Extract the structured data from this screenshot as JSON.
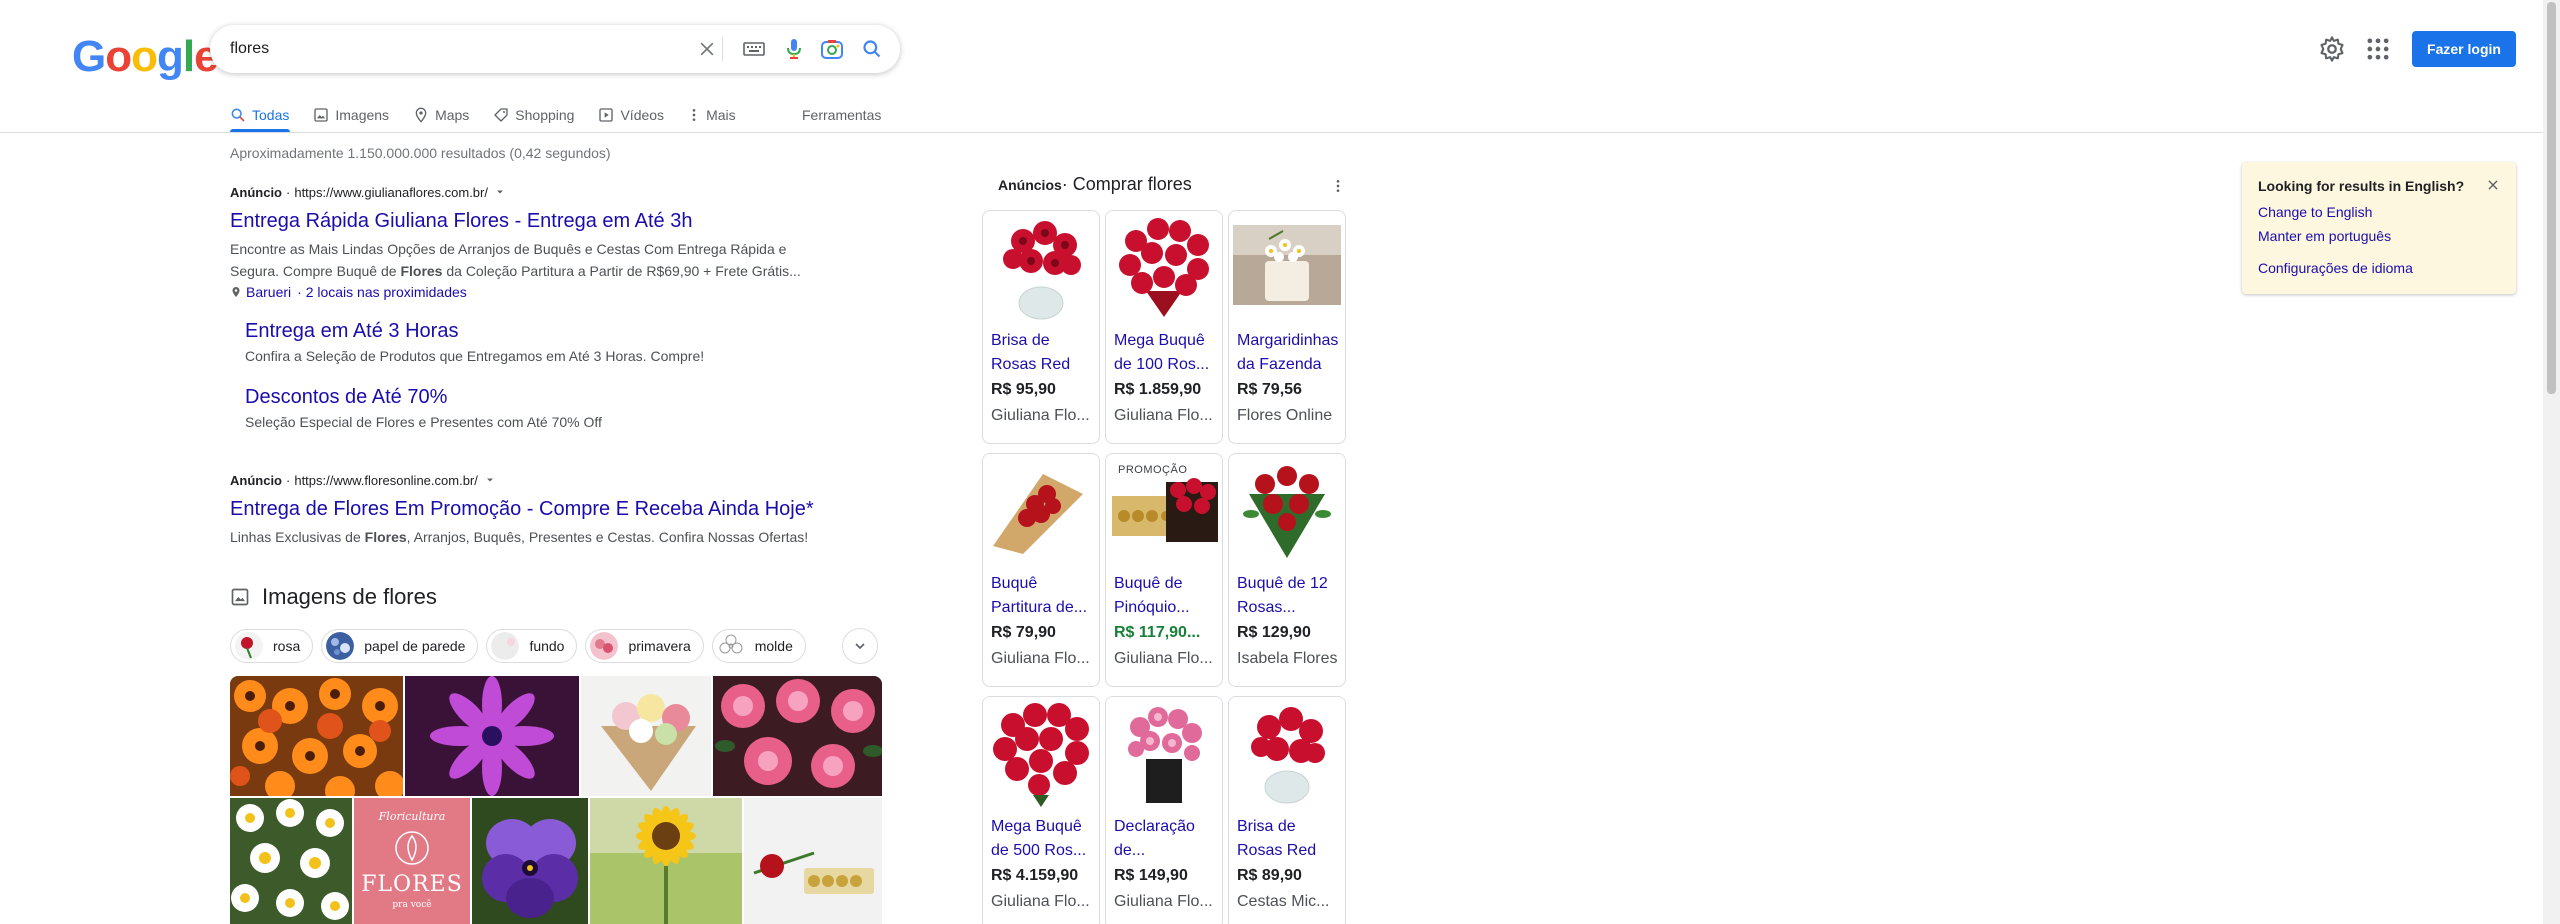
{
  "logo": [
    "G",
    "o",
    "o",
    "g",
    "l",
    "e"
  ],
  "search": {
    "value": "flores"
  },
  "header": {
    "login_label": "Fazer login"
  },
  "tabs": [
    {
      "label": "Todas"
    },
    {
      "label": "Imagens"
    },
    {
      "label": "Maps"
    },
    {
      "label": "Shopping"
    },
    {
      "label": "Vídeos"
    },
    {
      "label": "Mais"
    }
  ],
  "tools_label": "Ferramentas",
  "stats": "Aproximadamente 1.150.000.000 resultados (0,42 segundos)",
  "ads": [
    {
      "badge": "Anúncio",
      "sep": "·",
      "url": "https://www.giulianaflores.com.br/",
      "title": "Entrega Rápida Giuliana Flores - Entrega em Até 3h",
      "desc_1": "Encontre as Mais Lindas Opções de Arranjos de Buquês e Cestas Com Entrega Rápida e",
      "desc_2a": "Segura. Compre Buquê de ",
      "desc_2b": "Flores",
      "desc_2c": " da Coleção Partitura a Partir de R$69,90 + Frete Grátis...",
      "location": "Barueri",
      "location_extra": "· 2 locais nas proximidades",
      "sitelinks": [
        {
          "title": "Entrega em Até 3 Horas",
          "desc": "Confira a Seleção de Produtos que Entregamos em Até 3 Horas. Compre!"
        },
        {
          "title": "Descontos de Até 70%",
          "desc": "Seleção Especial de Flores e Presentes com Até 70% Off"
        }
      ]
    },
    {
      "badge": "Anúncio",
      "sep": "·",
      "url": "https://www.floresonline.com.br/",
      "title": "Entrega de Flores Em Promoção - Compre E Receba Ainda Hoje*",
      "desc_a": "Linhas Exclusivas de ",
      "desc_b": "Flores",
      "desc_c": ", Arranjos, Buquês, Presentes e Cestas. Confira Nossas Ofertas!"
    }
  ],
  "images_section": {
    "heading": "Imagens de flores",
    "chips": [
      "rosa",
      "papel de parede",
      "fundo",
      "primavera",
      "molde"
    ]
  },
  "shopping": {
    "label_bold": "Anúncios",
    "label": " · Comprar flores",
    "products": [
      {
        "title": "Brisa de Rosas Red",
        "price": "R$ 95,90",
        "store": "Giuliana Flo..."
      },
      {
        "title": "Mega Buquê de 100 Ros...",
        "price": "R$ 1.859,90",
        "store": "Giuliana Flo..."
      },
      {
        "title": "Margaridinhas da Fazenda",
        "price": "R$ 79,56",
        "store": "Flores Online"
      },
      {
        "title": "Buquê Partitura de...",
        "price": "R$ 79,90",
        "store": "Giuliana Flo..."
      },
      {
        "title": "Buquê de Pinóquio...",
        "price": "R$ 117,90...",
        "store": "Giuliana Flo...",
        "promo": "PROMOÇÃO"
      },
      {
        "title": "Buquê de 12 Rosas...",
        "price": "R$ 129,90",
        "store": "Isabela Flores"
      },
      {
        "title": "Mega Buquê de 500 Ros...",
        "price": "R$ 4.159,90",
        "store": "Giuliana Flo..."
      },
      {
        "title": "Declaração de...",
        "price": "R$ 149,90",
        "store": "Giuliana Flo..."
      },
      {
        "title": "Brisa de Rosas Red",
        "price": "R$ 89,90",
        "store": "Cestas Mic..."
      }
    ]
  },
  "language_box": {
    "title": "Looking for results in English?",
    "link_1": "Change to English",
    "link_2": "Manter em português",
    "link_3": "Configurações de idioma"
  },
  "colors": {
    "link": "#1a0dab",
    "accent": "#1a73e8",
    "sale_price": "#188038",
    "notice_bg": "#fef7e0"
  },
  "image_grid": {
    "tiles": [
      "orange daisy flowers",
      "purple osteospermum",
      "mixed bouquet in kraft paper",
      "pink roses",
      "white chamomile",
      "pink Floricultura Flores pra você logo",
      "purple pansy",
      "sunflower",
      "single rose with chocolates"
    ],
    "tile_texts": {
      "line_1": "Floricultura",
      "line_2": "FLORES",
      "line_3": "pra você"
    }
  }
}
